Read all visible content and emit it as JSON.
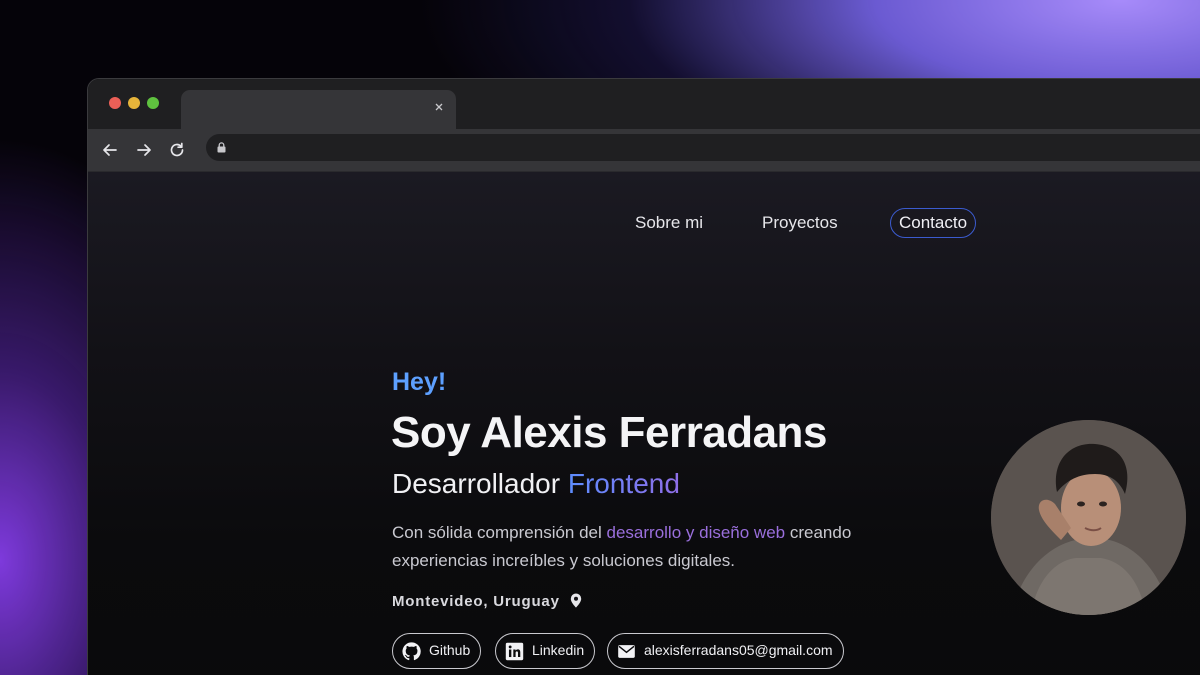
{
  "browser": {
    "tab_title": "",
    "url": ""
  },
  "nav": {
    "links": [
      "Sobre mi",
      "Proyectos",
      "Contacto"
    ]
  },
  "hero": {
    "greeting": "Hey!",
    "name": "Soy Alexis Ferradans",
    "role_prefix": "Desarrollador ",
    "role_accent": "Frontend",
    "description_start": "Con sólida comprensión del ",
    "description_accent": "desarrollo y diseño web",
    "description_end": " creando experiencias increíbles y soluciones digitales.",
    "location": "Montevideo, Uruguay"
  },
  "social": {
    "github": "Github",
    "linkedin": "Linkedin",
    "email": "alexisferradans05@gmail.com"
  },
  "colors": {
    "greeting": "#5da0ff",
    "accent_purple": "#9a6fdc",
    "contact_border": "#3b5bcf"
  },
  "icons": [
    "github-icon",
    "linkedin-icon",
    "mail-icon",
    "location-pin-icon",
    "lock-icon",
    "back-arrow-icon",
    "forward-arrow-icon",
    "reload-icon",
    "close-icon"
  ]
}
